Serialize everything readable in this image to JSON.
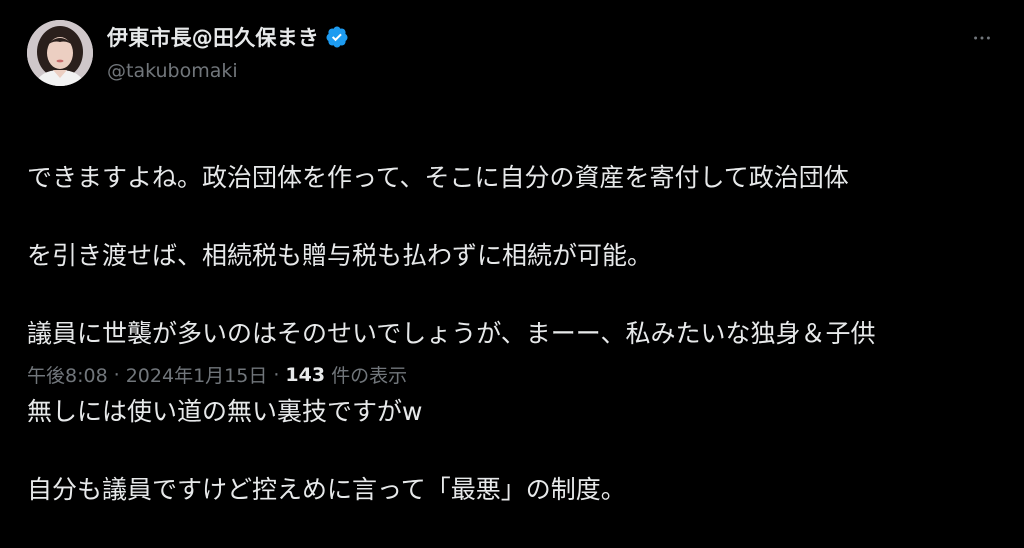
{
  "author": {
    "display_name": "伊東市長@田久保まき",
    "handle": "@takubomaki",
    "verified_color": "#1d9bf0"
  },
  "tweet": {
    "lines": [
      "できますよね。政治団体を作って、そこに自分の資産を寄付して政治団体",
      "を引き渡せば、相続税も贈与税も払わずに相続が可能。",
      "議員に世襲が多いのはそのせいでしょうが、まーー、私みたいな独身＆子供",
      "無しには使い道の無い裏技ですがw",
      "自分も議員ですけど控えめに言って「最悪」の制度。"
    ]
  },
  "meta": {
    "time": "午後8:08",
    "separator": "·",
    "date": "2024年1月15日",
    "views_count": "143",
    "views_label": "件の表示"
  },
  "icons": {
    "more": "more-dots-icon",
    "verified": "verified-badge-icon"
  }
}
